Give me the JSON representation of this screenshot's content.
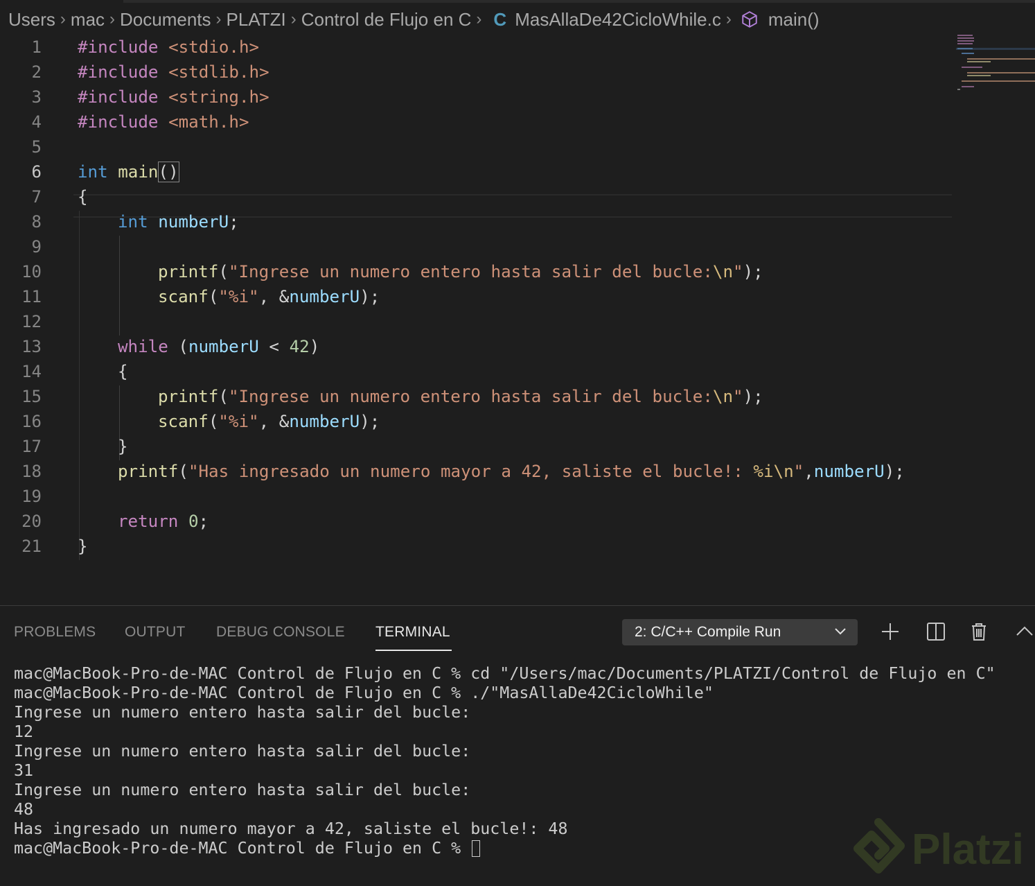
{
  "breadcrumb": {
    "items": [
      "Users",
      "mac",
      "Documents",
      "PLATZI",
      "Control de Flujo en C"
    ],
    "file_icon": "C",
    "file": "MasAllaDe42CicloWhile.c",
    "symbol": "main()"
  },
  "editor": {
    "active_line": 6,
    "lines": [
      {
        "n": "1"
      },
      {
        "n": "2"
      },
      {
        "n": "3"
      },
      {
        "n": "4"
      },
      {
        "n": "5"
      },
      {
        "n": "6"
      },
      {
        "n": "7"
      },
      {
        "n": "8"
      },
      {
        "n": "9"
      },
      {
        "n": "10"
      },
      {
        "n": "11"
      },
      {
        "n": "12"
      },
      {
        "n": "13"
      },
      {
        "n": "14"
      },
      {
        "n": "15"
      },
      {
        "n": "16"
      },
      {
        "n": "17"
      },
      {
        "n": "18"
      },
      {
        "n": "19"
      },
      {
        "n": "20"
      },
      {
        "n": "21"
      }
    ],
    "code": {
      "l1": [
        "#include",
        " ",
        "<stdio.h>"
      ],
      "l2": [
        "#include",
        " ",
        "<stdlib.h>"
      ],
      "l3": [
        "#include",
        " ",
        "<string.h>"
      ],
      "l4": [
        "#include",
        " ",
        "<math.h>"
      ],
      "l6": [
        "int",
        " ",
        "main",
        "(",
        ")"
      ],
      "l7": [
        "{"
      ],
      "l8": [
        "int",
        " ",
        "numberU",
        ";"
      ],
      "l10": [
        "printf",
        "(",
        "\"Ingrese un numero entero hasta salir del bucle:",
        "\\n",
        "\"",
        ");"
      ],
      "l11": [
        "scanf",
        "(",
        "\"%i\"",
        ", &",
        "numberU",
        ");"
      ],
      "l13": [
        "while",
        " (",
        "numberU",
        " < ",
        "42",
        ")"
      ],
      "l14": [
        "{"
      ],
      "l15": [
        "printf",
        "(",
        "\"Ingrese un numero entero hasta salir del bucle:",
        "\\n",
        "\"",
        ");"
      ],
      "l16": [
        "scanf",
        "(",
        "\"%i\"",
        ", &",
        "numberU",
        ");"
      ],
      "l17": [
        "}"
      ],
      "l18": [
        "printf",
        "(",
        "\"Has ingresado un numero mayor a 42, saliste el bucle!: ",
        "%i",
        "\\n",
        "\"",
        ",",
        "numberU",
        ");"
      ],
      "l20": [
        "return",
        " ",
        "0",
        ";"
      ],
      "l21": [
        "}"
      ]
    }
  },
  "panel": {
    "tabs": [
      "PROBLEMS",
      "OUTPUT",
      "DEBUG CONSOLE",
      "TERMINAL"
    ],
    "active_tab": "TERMINAL",
    "terminal_select": "2: C/C++ Compile Run",
    "icons": [
      "plus-icon",
      "split-icon",
      "trash-icon",
      "chevron-up-icon"
    ],
    "terminal_lines": [
      "mac@MacBook-Pro-de-MAC Control de Flujo en C % cd \"/Users/mac/Documents/PLATZI/Control de Flujo en C\"",
      "mac@MacBook-Pro-de-MAC Control de Flujo en C % ./\"MasAllaDe42CicloWhile\"",
      "Ingrese un numero entero hasta salir del bucle:",
      "12",
      "Ingrese un numero entero hasta salir del bucle:",
      "31",
      "Ingrese un numero entero hasta salir del bucle:",
      "48",
      "Has ingresado un numero mayor a 42, saliste el bucle!: 48"
    ],
    "prompt": "mac@MacBook-Pro-de-MAC Control de Flujo en C % "
  },
  "watermark": "Platzi",
  "colors": {
    "background": "#1e1e1e",
    "keyword": "#569cd6",
    "control": "#c586c0",
    "function": "#dcdcaa",
    "variable": "#9cdcfe",
    "string": "#ce9178",
    "number": "#b5cea8"
  }
}
